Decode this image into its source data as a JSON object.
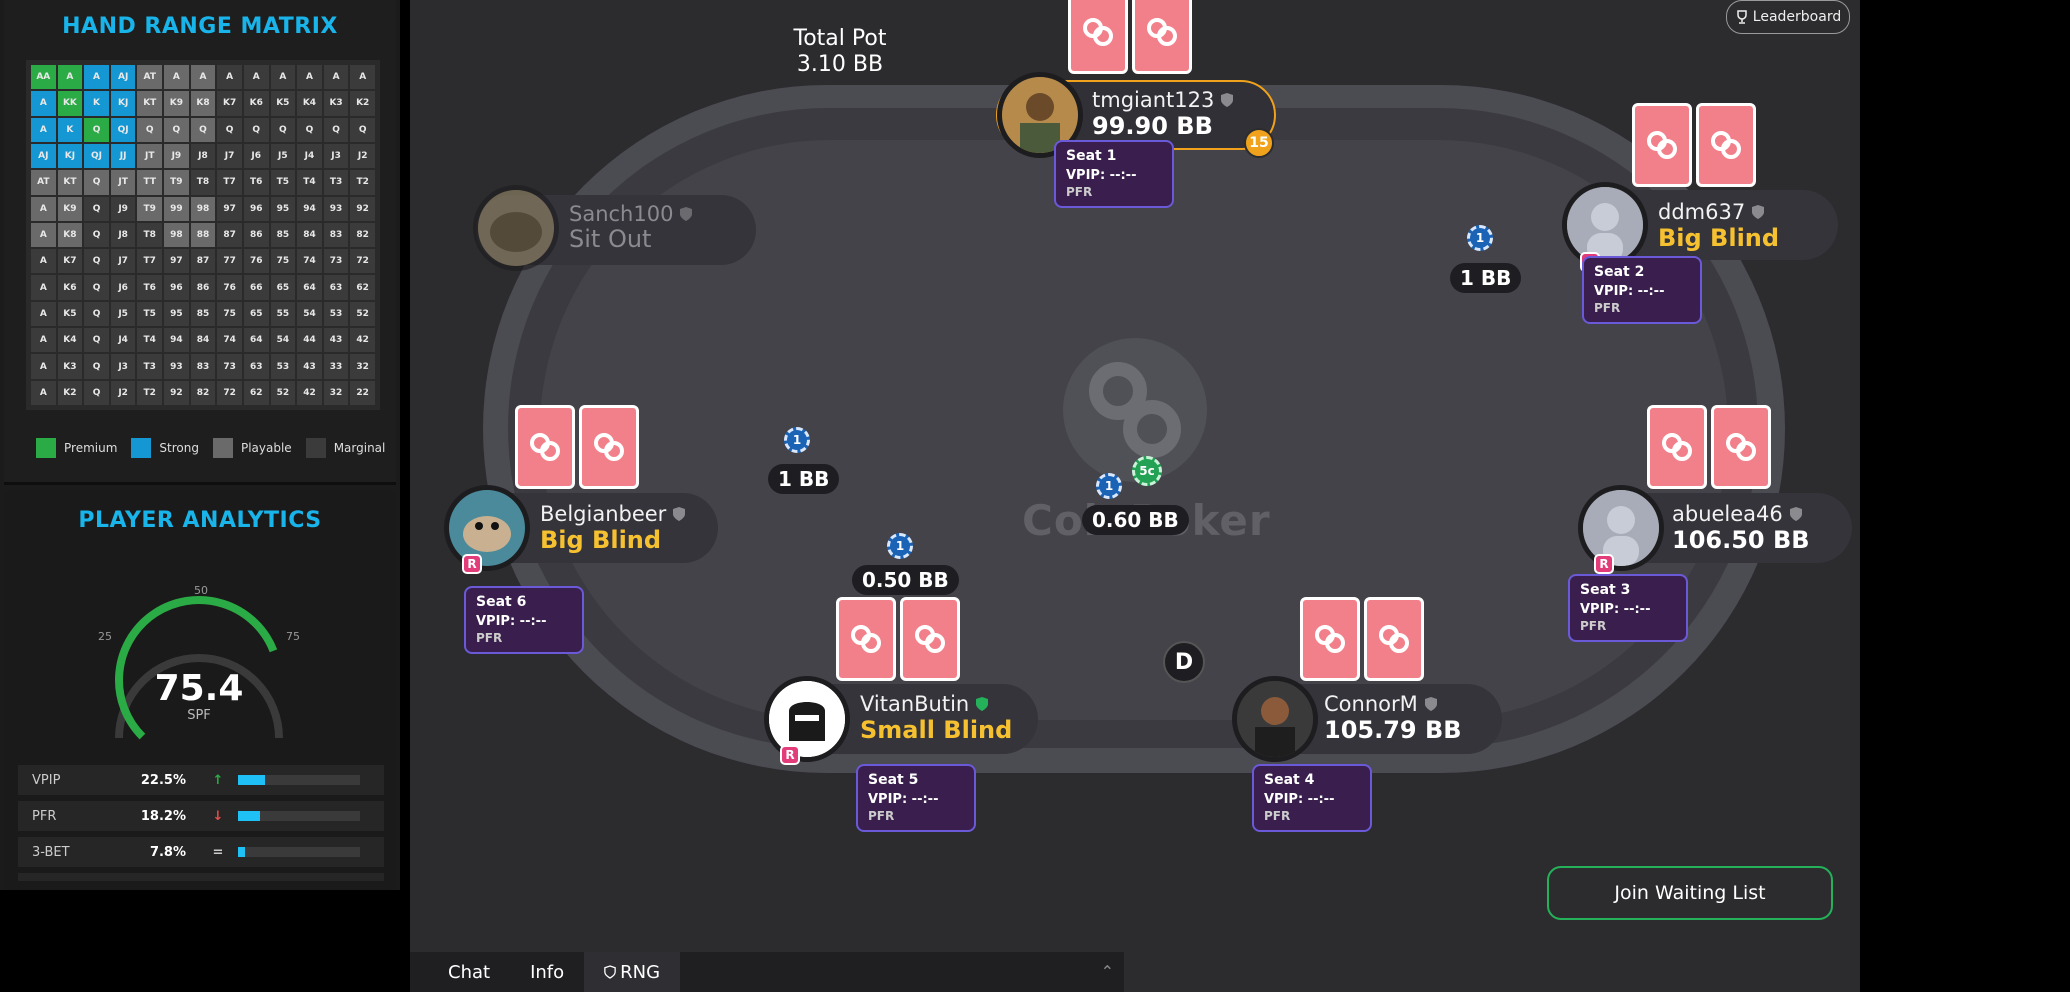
{
  "sidebar": {
    "range_title": "HAND RANGE MATRIX",
    "matrix": [
      [
        [
          "AA",
          "premium"
        ],
        [
          "A",
          "premium"
        ],
        [
          "A",
          "strong"
        ],
        [
          "AJ",
          "strong"
        ],
        [
          "AT",
          "playable"
        ],
        [
          "A",
          "playable"
        ],
        [
          "A",
          "playable"
        ],
        [
          "A",
          "marginal"
        ],
        [
          "A",
          "marginal"
        ],
        [
          "A",
          "marginal"
        ],
        [
          "A",
          "marginal"
        ],
        [
          "A",
          "marginal"
        ],
        [
          "A",
          "marginal"
        ]
      ],
      [
        [
          "A",
          "strong"
        ],
        [
          "KK",
          "premium"
        ],
        [
          "K",
          "strong"
        ],
        [
          "KJ",
          "strong"
        ],
        [
          "KT",
          "playable"
        ],
        [
          "K9",
          "playable"
        ],
        [
          "K8",
          "playable"
        ],
        [
          "K7",
          "marginal"
        ],
        [
          "K6",
          "marginal"
        ],
        [
          "K5",
          "marginal"
        ],
        [
          "K4",
          "marginal"
        ],
        [
          "K3",
          "marginal"
        ],
        [
          "K2",
          "marginal"
        ]
      ],
      [
        [
          "A",
          "strong"
        ],
        [
          "K",
          "strong"
        ],
        [
          "Q",
          "premium"
        ],
        [
          "QJ",
          "strong"
        ],
        [
          "Q",
          "playable"
        ],
        [
          "Q",
          "playable"
        ],
        [
          "Q",
          "playable"
        ],
        [
          "Q",
          "marginal"
        ],
        [
          "Q",
          "marginal"
        ],
        [
          "Q",
          "marginal"
        ],
        [
          "Q",
          "marginal"
        ],
        [
          "Q",
          "marginal"
        ],
        [
          "Q",
          "marginal"
        ]
      ],
      [
        [
          "AJ",
          "strong"
        ],
        [
          "KJ",
          "strong"
        ],
        [
          "QJ",
          "strong"
        ],
        [
          "JJ",
          "strong"
        ],
        [
          "JT",
          "playable"
        ],
        [
          "J9",
          "playable"
        ],
        [
          "J8",
          "marginal"
        ],
        [
          "J7",
          "marginal"
        ],
        [
          "J6",
          "marginal"
        ],
        [
          "J5",
          "marginal"
        ],
        [
          "J4",
          "marginal"
        ],
        [
          "J3",
          "marginal"
        ],
        [
          "J2",
          "marginal"
        ]
      ],
      [
        [
          "AT",
          "playable"
        ],
        [
          "KT",
          "playable"
        ],
        [
          "Q",
          "playable"
        ],
        [
          "JT",
          "playable"
        ],
        [
          "TT",
          "playable"
        ],
        [
          "T9",
          "playable"
        ],
        [
          "T8",
          "marginal"
        ],
        [
          "T7",
          "marginal"
        ],
        [
          "T6",
          "marginal"
        ],
        [
          "T5",
          "marginal"
        ],
        [
          "T4",
          "marginal"
        ],
        [
          "T3",
          "marginal"
        ],
        [
          "T2",
          "marginal"
        ]
      ],
      [
        [
          "A",
          "playable"
        ],
        [
          "K9",
          "playable"
        ],
        [
          "Q",
          "marginal"
        ],
        [
          "J9",
          "marginal"
        ],
        [
          "T9",
          "playable"
        ],
        [
          "99",
          "playable"
        ],
        [
          "98",
          "playable"
        ],
        [
          "97",
          "marginal"
        ],
        [
          "96",
          "marginal"
        ],
        [
          "95",
          "marginal"
        ],
        [
          "94",
          "marginal"
        ],
        [
          "93",
          "marginal"
        ],
        [
          "92",
          "marginal"
        ]
      ],
      [
        [
          "A",
          "playable"
        ],
        [
          "K8",
          "playable"
        ],
        [
          "Q",
          "marginal"
        ],
        [
          "J8",
          "marginal"
        ],
        [
          "T8",
          "marginal"
        ],
        [
          "98",
          "playable"
        ],
        [
          "88",
          "playable"
        ],
        [
          "87",
          "marginal"
        ],
        [
          "86",
          "marginal"
        ],
        [
          "85",
          "marginal"
        ],
        [
          "84",
          "marginal"
        ],
        [
          "83",
          "marginal"
        ],
        [
          "82",
          "marginal"
        ]
      ],
      [
        [
          "A",
          "marginal"
        ],
        [
          "K7",
          "marginal"
        ],
        [
          "Q",
          "marginal"
        ],
        [
          "J7",
          "marginal"
        ],
        [
          "T7",
          "marginal"
        ],
        [
          "97",
          "marginal"
        ],
        [
          "87",
          "marginal"
        ],
        [
          "77",
          "marginal"
        ],
        [
          "76",
          "marginal"
        ],
        [
          "75",
          "marginal"
        ],
        [
          "74",
          "marginal"
        ],
        [
          "73",
          "marginal"
        ],
        [
          "72",
          "marginal"
        ]
      ],
      [
        [
          "A",
          "marginal"
        ],
        [
          "K6",
          "marginal"
        ],
        [
          "Q",
          "marginal"
        ],
        [
          "J6",
          "marginal"
        ],
        [
          "T6",
          "marginal"
        ],
        [
          "96",
          "marginal"
        ],
        [
          "86",
          "marginal"
        ],
        [
          "76",
          "marginal"
        ],
        [
          "66",
          "marginal"
        ],
        [
          "65",
          "marginal"
        ],
        [
          "64",
          "marginal"
        ],
        [
          "63",
          "marginal"
        ],
        [
          "62",
          "marginal"
        ]
      ],
      [
        [
          "A",
          "marginal"
        ],
        [
          "K5",
          "marginal"
        ],
        [
          "Q",
          "marginal"
        ],
        [
          "J5",
          "marginal"
        ],
        [
          "T5",
          "marginal"
        ],
        [
          "95",
          "marginal"
        ],
        [
          "85",
          "marginal"
        ],
        [
          "75",
          "marginal"
        ],
        [
          "65",
          "marginal"
        ],
        [
          "55",
          "marginal"
        ],
        [
          "54",
          "marginal"
        ],
        [
          "53",
          "marginal"
        ],
        [
          "52",
          "marginal"
        ]
      ],
      [
        [
          "A",
          "marginal"
        ],
        [
          "K4",
          "marginal"
        ],
        [
          "Q",
          "marginal"
        ],
        [
          "J4",
          "marginal"
        ],
        [
          "T4",
          "marginal"
        ],
        [
          "94",
          "marginal"
        ],
        [
          "84",
          "marginal"
        ],
        [
          "74",
          "marginal"
        ],
        [
          "64",
          "marginal"
        ],
        [
          "54",
          "marginal"
        ],
        [
          "44",
          "marginal"
        ],
        [
          "43",
          "marginal"
        ],
        [
          "42",
          "marginal"
        ]
      ],
      [
        [
          "A",
          "marginal"
        ],
        [
          "K3",
          "marginal"
        ],
        [
          "Q",
          "marginal"
        ],
        [
          "J3",
          "marginal"
        ],
        [
          "T3",
          "marginal"
        ],
        [
          "93",
          "marginal"
        ],
        [
          "83",
          "marginal"
        ],
        [
          "73",
          "marginal"
        ],
        [
          "63",
          "marginal"
        ],
        [
          "53",
          "marginal"
        ],
        [
          "43",
          "marginal"
        ],
        [
          "33",
          "marginal"
        ],
        [
          "32",
          "marginal"
        ]
      ],
      [
        [
          "A",
          "marginal"
        ],
        [
          "K2",
          "marginal"
        ],
        [
          "Q",
          "marginal"
        ],
        [
          "J2",
          "marginal"
        ],
        [
          "T2",
          "marginal"
        ],
        [
          "92",
          "marginal"
        ],
        [
          "82",
          "marginal"
        ],
        [
          "72",
          "marginal"
        ],
        [
          "62",
          "marginal"
        ],
        [
          "52",
          "marginal"
        ],
        [
          "42",
          "marginal"
        ],
        [
          "32",
          "marginal"
        ],
        [
          "22",
          "marginal"
        ]
      ]
    ],
    "legend": [
      {
        "label": "Premium",
        "tier": "premium"
      },
      {
        "label": "Strong",
        "tier": "strong"
      },
      {
        "label": "Playable",
        "tier": "playable"
      },
      {
        "label": "Marginal",
        "tier": "marginal"
      }
    ],
    "analytics_title": "PLAYER ANALYTICS",
    "gauge": {
      "value": "75.4",
      "value_num": 75.4,
      "label": "SPF",
      "tick_25": "25",
      "tick_50": "50",
      "tick_75": "75"
    },
    "stats": [
      {
        "name": "VPIP",
        "value": "22.5%",
        "trend": "↑",
        "trend_color": "#2bab45",
        "fill": 0.22
      },
      {
        "name": "PFR",
        "value": "18.2%",
        "trend": "↓",
        "trend_color": "#e24c4c",
        "fill": 0.18
      },
      {
        "name": "3-BET",
        "value": "7.8%",
        "trend": "=",
        "trend_color": "#cccccc",
        "fill": 0.06
      }
    ]
  },
  "table": {
    "total_pot_label": "Total Pot",
    "total_pot_value": "3.10 BB",
    "leaderboard_label": "Leaderboard",
    "logo_text": "CoinPoker",
    "dealer_label": "D",
    "center_pot": {
      "chip": "1",
      "chip2": "5c",
      "amount": "0.60 BB"
    },
    "timer": "15",
    "join_label": "Join Waiting List",
    "colors": {
      "accent": "#18b4ea",
      "blind": "#f6c131",
      "card": "#f2808a",
      "join_border": "#25b15a",
      "seatbox": "#3a1f4e"
    }
  },
  "players": {
    "tmgiant": {
      "name": "tmgiant123",
      "stack": "99.90 BB",
      "seat": "Seat 1",
      "vpip": "VPIP: --:--",
      "pfr": "PFR"
    },
    "ddm": {
      "name": "ddm637",
      "stack": "Big Blind",
      "seat": "Seat 2",
      "vpip": "VPIP: --:--",
      "pfr": "PFR",
      "bet": "1 BB",
      "chip": "1"
    },
    "abuelea": {
      "name": "abuelea46",
      "stack": "106.50 BB",
      "seat": "Seat 3",
      "vpip": "VPIP: --:--",
      "pfr": "PFR"
    },
    "connor": {
      "name": "ConnorM",
      "stack": "105.79 BB",
      "seat": "Seat 4",
      "vpip": "VPIP: --:--",
      "pfr": "PFR"
    },
    "vitan": {
      "name": "VitanButin",
      "stack": "Small Blind",
      "seat": "Seat 5",
      "vpip": "VPIP: --:--",
      "pfr": "PFR",
      "bet": "0.50 BB",
      "chip": "1"
    },
    "belgian": {
      "name": "Belgianbeer",
      "stack": "Big Blind",
      "seat": "Seat 6",
      "vpip": "VPIP: --:--",
      "pfr": "PFR",
      "bet": "1 BB",
      "chip": "1"
    },
    "sanch": {
      "name": "Sanch100",
      "stack": "Sit Out"
    }
  },
  "badge_r": "R",
  "tabs": [
    {
      "label": "Chat"
    },
    {
      "label": "Info"
    },
    {
      "label": "RNG"
    }
  ]
}
